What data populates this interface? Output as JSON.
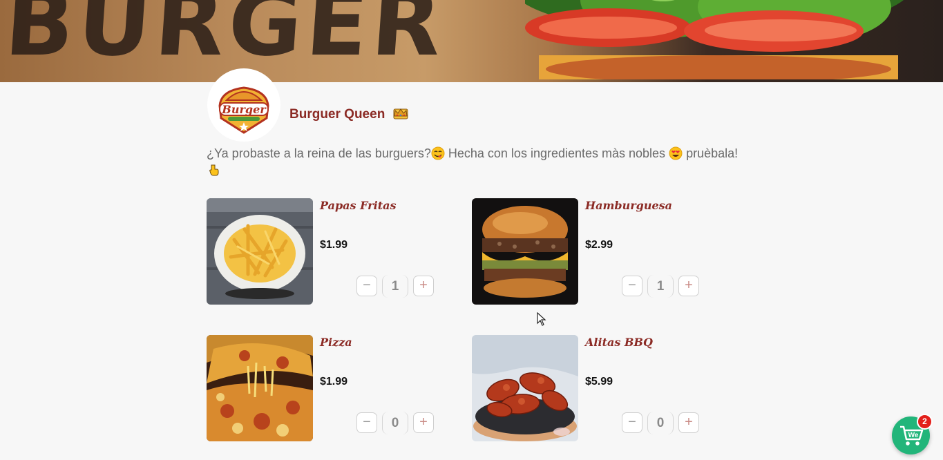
{
  "banner": {
    "text": "BURGER"
  },
  "store": {
    "logo_text": "Burger",
    "name": "Burguer Queen",
    "crown_icon": "crown-icon",
    "description_1": "¿Ya probaste a la reina de las burguers?",
    "description_2": " Hecha con los ingredientes màs nobles ",
    "description_3": " pruèbala!",
    "emojis": [
      "yum-face-icon",
      "heart-eyes-icon",
      "pointing-down-icon"
    ]
  },
  "products": [
    {
      "name": "Papas Fritas",
      "price": "$1.99",
      "quantity": "1",
      "image": "fries-photo"
    },
    {
      "name": "Hamburguesa",
      "price": "$2.99",
      "quantity": "1",
      "image": "burger-photo"
    },
    {
      "name": "Pizza",
      "price": "$1.99",
      "quantity": "0",
      "image": "pizza-photo"
    },
    {
      "name": "Alitas BBQ",
      "price": "$5.99",
      "quantity": "0",
      "image": "bbq-wings-photo"
    }
  ],
  "quantity_controls": {
    "minus": "−",
    "plus": "+"
  },
  "cart": {
    "icon_text": "We",
    "count": "2"
  },
  "colors": {
    "brand": "#8b2a24",
    "cart": "#22b57a",
    "badge": "#e3201b"
  }
}
